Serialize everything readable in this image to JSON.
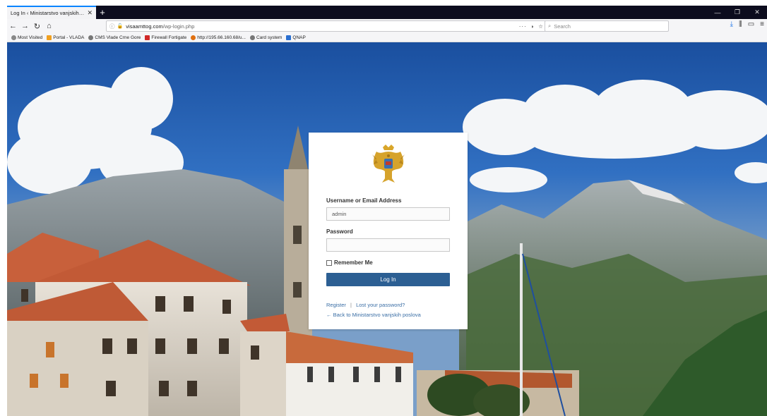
{
  "browser": {
    "tab_title": "Log In ‹ Ministarstvo vanjskih poslo",
    "tab_close": "✕",
    "new_tab": "+",
    "url_prefix": "visaamttog.com",
    "url_path": "/wp-login.php",
    "url_actions": "···",
    "search_placeholder": "Search",
    "bookmarks": [
      {
        "label": "Most Visited",
        "color": "#888888"
      },
      {
        "label": "Portal - VLADA",
        "color": "#f0a020"
      },
      {
        "label": "CMS Vlade Crne Gore",
        "color": "#777777"
      },
      {
        "label": "Firewall Fortigate",
        "color": "#d02828"
      },
      {
        "label": "http://195.66.160.68/u...",
        "color": "#e07010"
      },
      {
        "label": "Card system",
        "color": "#777777"
      },
      {
        "label": "QNAP",
        "color": "#2a6fd0"
      }
    ]
  },
  "login": {
    "username_label": "Username or Email Address",
    "username_value": "admin",
    "password_label": "Password",
    "password_value": "",
    "remember_label": "Remember Me",
    "submit_label": "Log In",
    "register_link": "Register",
    "separator": "|",
    "lost_password_link": "Lost your password?",
    "back_link": "← Back to Ministarstvo vanjskih poslova"
  },
  "colors": {
    "button": "#2c5f93",
    "link": "#3a6ea5",
    "tabbar": "#0c0c1e"
  }
}
